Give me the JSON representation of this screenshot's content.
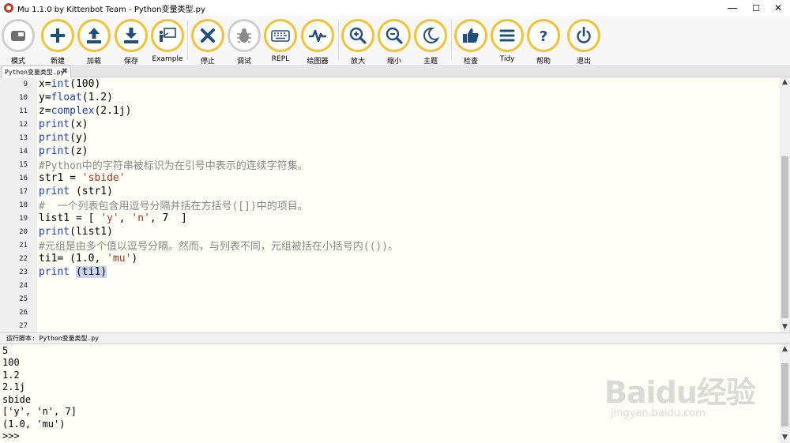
{
  "window": {
    "title": "Mu 1.1.0 by Kittenbot Team - Python变量类型.py",
    "minimize": "—",
    "maximize": "☐",
    "close": "✕"
  },
  "toolbar": {
    "accent": "#f5c22e",
    "buttons": [
      {
        "label": "模式",
        "icon": "mode-icon"
      },
      {
        "label": "新建",
        "icon": "plus-icon"
      },
      {
        "label": "加载",
        "icon": "upload-icon"
      },
      {
        "label": "保存",
        "icon": "download-icon"
      },
      {
        "label": "Example",
        "icon": "presenter-icon"
      },
      {
        "label": "停止",
        "icon": "close-icon"
      },
      {
        "label": "调试",
        "icon": "bug-icon"
      },
      {
        "label": "REPL",
        "icon": "keyboard-icon"
      },
      {
        "label": "绘图器",
        "icon": "pulse-icon"
      },
      {
        "label": "放大",
        "icon": "zoom-in-icon"
      },
      {
        "label": "缩小",
        "icon": "zoom-out-icon"
      },
      {
        "label": "主题",
        "icon": "moon-icon"
      },
      {
        "label": "检查",
        "icon": "thumbs-up-icon"
      },
      {
        "label": "Tidy",
        "icon": "lines-icon"
      },
      {
        "label": "帮助",
        "icon": "question-icon"
      },
      {
        "label": "退出",
        "icon": "power-icon"
      }
    ]
  },
  "tab": {
    "label": "Python变量类型.py",
    "close": "✖"
  },
  "editor": {
    "lines": [
      {
        "num": "9",
        "text": "x=int(100)"
      },
      {
        "num": "10",
        "text": "y=float(1.2)"
      },
      {
        "num": "11",
        "text": "z=complex(2.1j)"
      },
      {
        "num": "12",
        "text": "print(x)"
      },
      {
        "num": "13",
        "text": "print(y)"
      },
      {
        "num": "14",
        "text": "print(z)"
      },
      {
        "num": "15",
        "text": "#Python中的字符串被标识为在引号中表示的连续字符集。"
      },
      {
        "num": "16",
        "text": "str1 = 'sbide'"
      },
      {
        "num": "17",
        "text": "print (str1)"
      },
      {
        "num": "18",
        "text": "#  一个列表包含用逗号分隔并括在方括号([])中的项目。"
      },
      {
        "num": "19",
        "text": "list1 = [ 'y', 'n', 7  ]"
      },
      {
        "num": "20",
        "text": "print(list1)"
      },
      {
        "num": "21",
        "text": "#元组是由多个值以逗号分隔。然而，与列表不同，元组被括在小括号内(())。"
      },
      {
        "num": "22",
        "text": "ti1= (1.0, 'mu')"
      },
      {
        "num": "23",
        "text": "print (ti1)"
      },
      {
        "num": "24",
        "text": ""
      },
      {
        "num": "25",
        "text": ""
      },
      {
        "num": "26",
        "text": ""
      },
      {
        "num": "27",
        "text": ""
      }
    ]
  },
  "run": {
    "label": "运行脚本: Python变量类型.py"
  },
  "output": {
    "lines": [
      "5",
      "100",
      "1.2",
      "2.1j",
      "sbide",
      "['y', 'n', 7]",
      "(1.0, 'mu')",
      ">>>"
    ]
  },
  "watermark": {
    "main": "Baidu经验",
    "sub": "jingyan.baidu.com"
  }
}
